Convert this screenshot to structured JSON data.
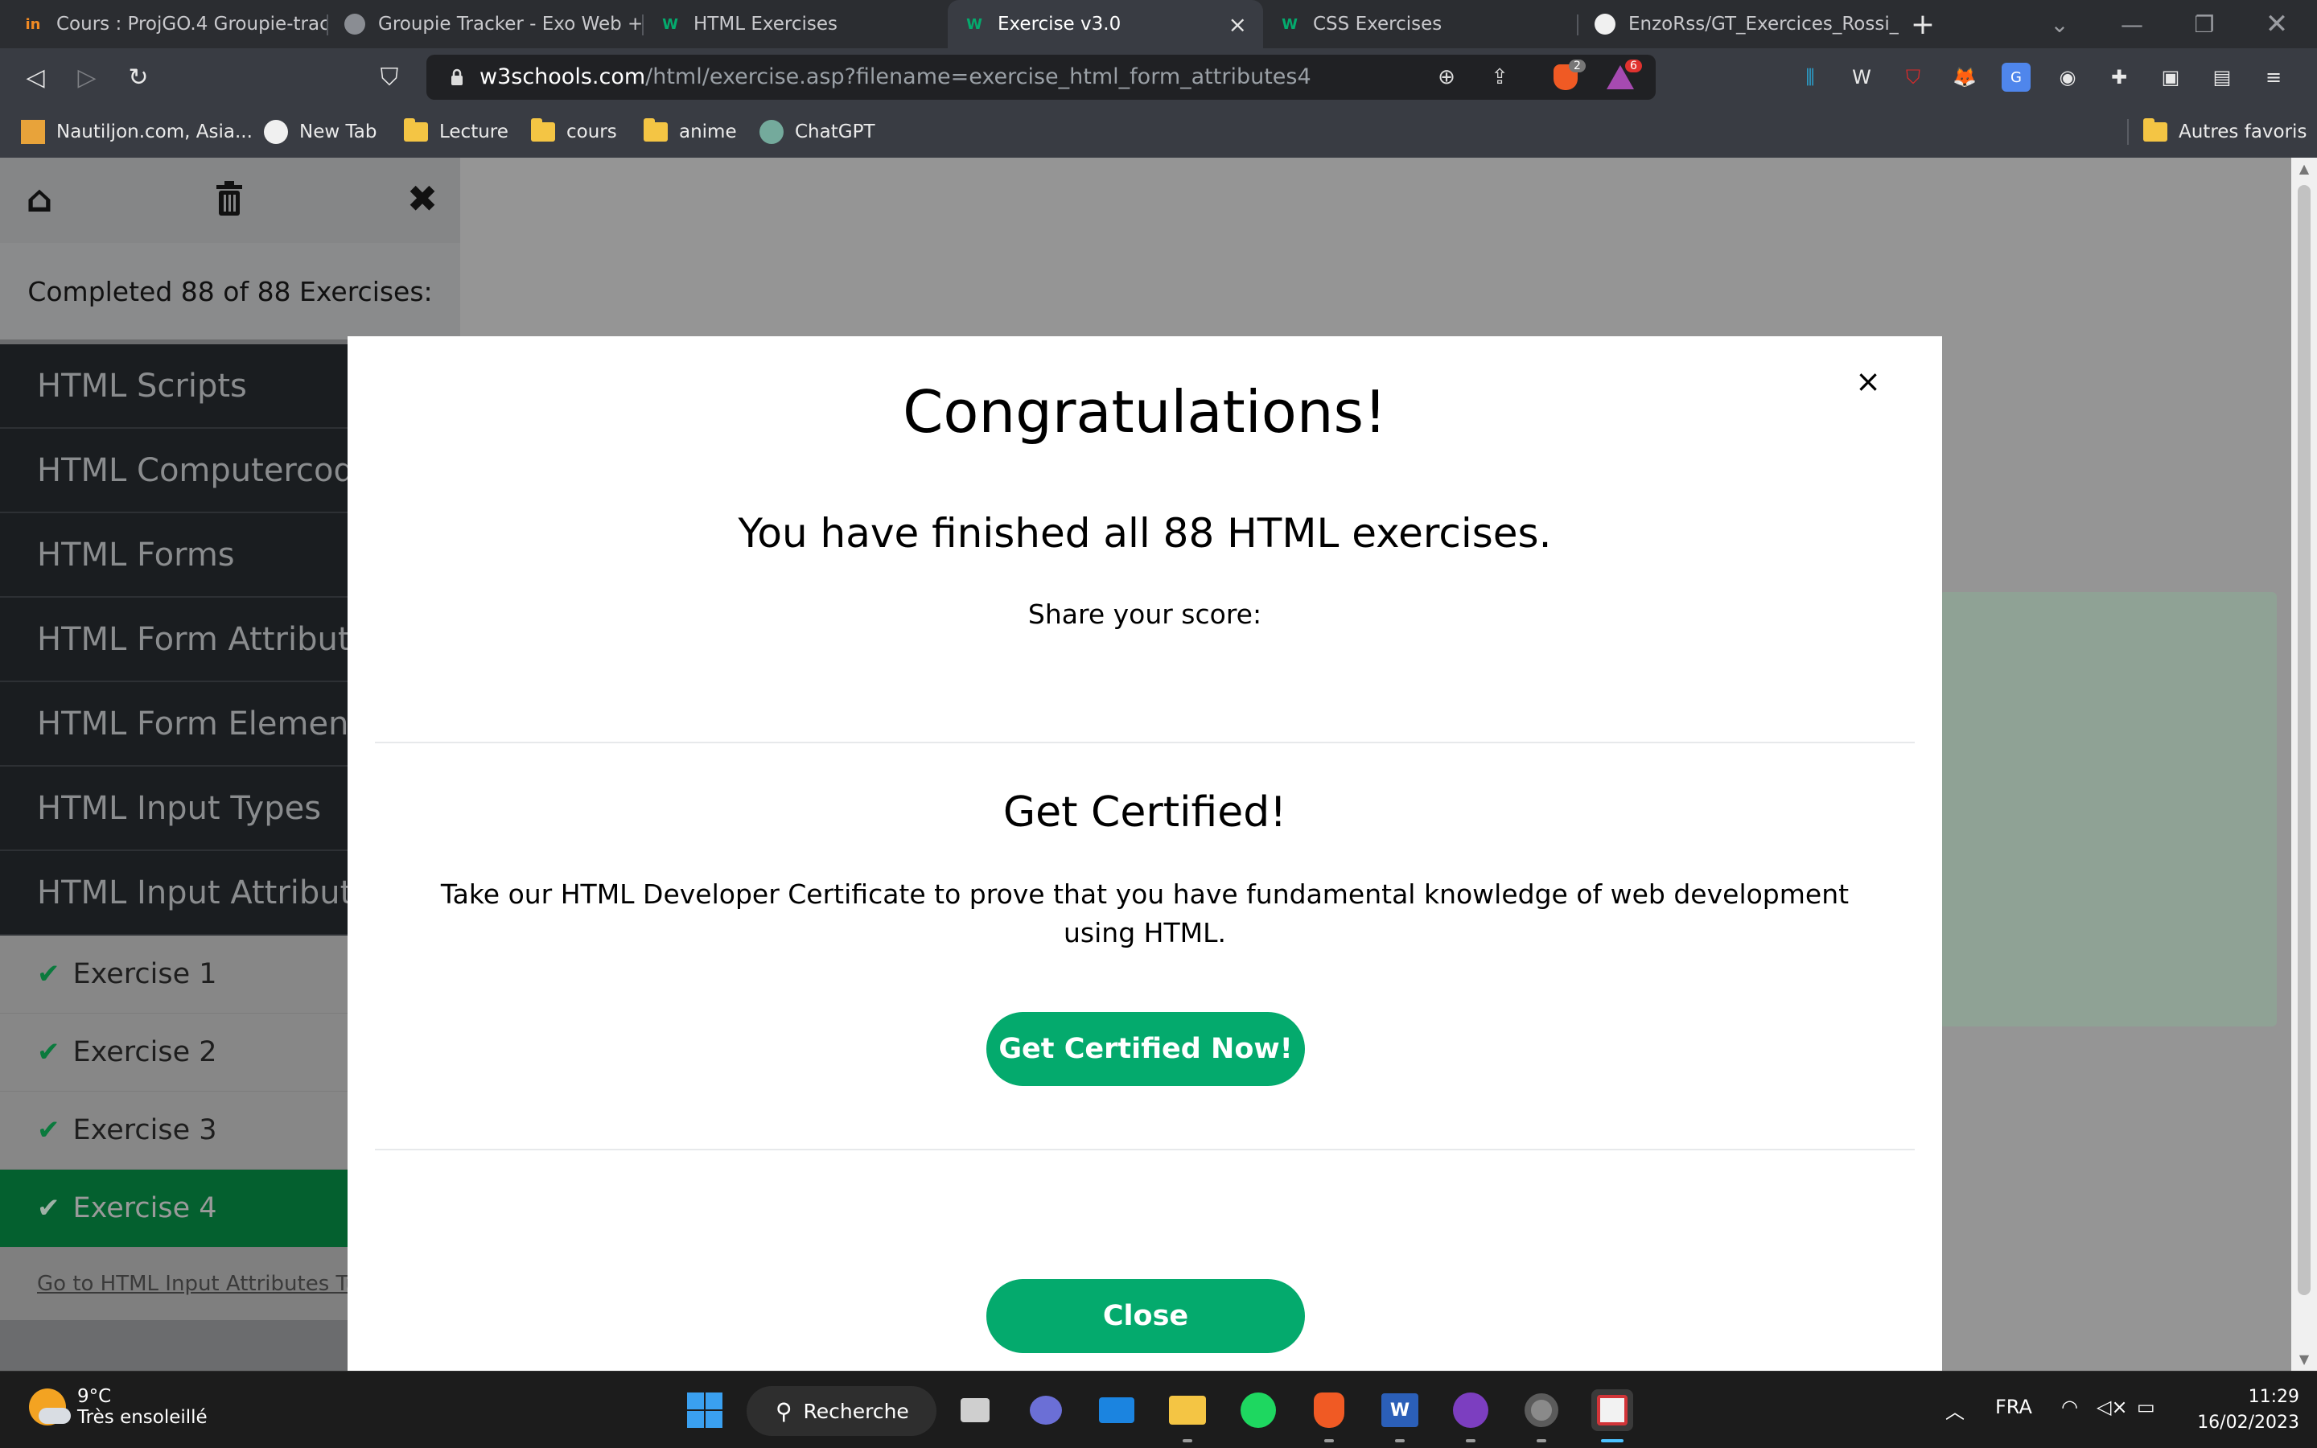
{
  "browser": {
    "tabs": [
      {
        "title": "Cours : ProjGO.4 Groupie-trac",
        "favicon": "in-logo-icon"
      },
      {
        "title": "Groupie Tracker - Exo Web + (",
        "favicon": "globe-icon"
      },
      {
        "title": "HTML Exercises",
        "favicon": "w3schools-icon"
      },
      {
        "title": "Exercise v3.0",
        "favicon": "w3schools-icon",
        "active": true
      },
      {
        "title": "CSS Exercises",
        "favicon": "w3schools-icon"
      },
      {
        "title": "EnzoRss/GT_Exercices_Rossi_E",
        "favicon": "github-icon"
      }
    ],
    "url_host": "w3schools.com",
    "url_path": "/html/exercise.asp?filename=exercise_html_form_attributes4",
    "badges": {
      "brave_shields": "2",
      "brave_rewards": "6"
    },
    "bookmarks": [
      {
        "label": "Nautiljon.com, Asia...",
        "icon": "nautiljon-icon"
      },
      {
        "label": "New Tab",
        "icon": "github-icon"
      },
      {
        "label": "Lecture",
        "icon": "folder-icon"
      },
      {
        "label": "cours",
        "icon": "folder-icon"
      },
      {
        "label": "anime",
        "icon": "folder-icon"
      },
      {
        "label": "ChatGPT",
        "icon": "chatgpt-icon"
      }
    ],
    "other_bookmarks": "Autres favoris"
  },
  "sidebar": {
    "completed": "Completed 88 of 88 Exercises:",
    "items": [
      "HTML Scripts",
      "HTML Computercode",
      "HTML Forms",
      "HTML Form Attributes",
      "HTML Form Elements",
      "HTML Input Types",
      "HTML Input Attributes"
    ],
    "exercises": [
      "Exercise 1",
      "Exercise 2",
      "Exercise 3",
      "Exercise 4"
    ],
    "active_exercise": "Exercise 4",
    "tutorial_link": "Go to HTML Input Attributes Tutorial"
  },
  "modal": {
    "title": "Congratulations!",
    "finished": "You have finished all 88 HTML exercises.",
    "share": "Share your score:",
    "cert_title": "Get Certified!",
    "cert_text": "Take our HTML Developer Certificate to prove that you have fundamental knowledge of web development using HTML.",
    "cert_button": "Get Certified Now!",
    "close_button": "Close",
    "close_icon": "×",
    "accent_color": "#04aa6d"
  },
  "taskbar": {
    "weather_temp": "9°C",
    "weather_text": "Très ensoleillé",
    "search_label": "Recherche",
    "language": "FRA",
    "time": "11:29",
    "date": "16/02/2023"
  }
}
